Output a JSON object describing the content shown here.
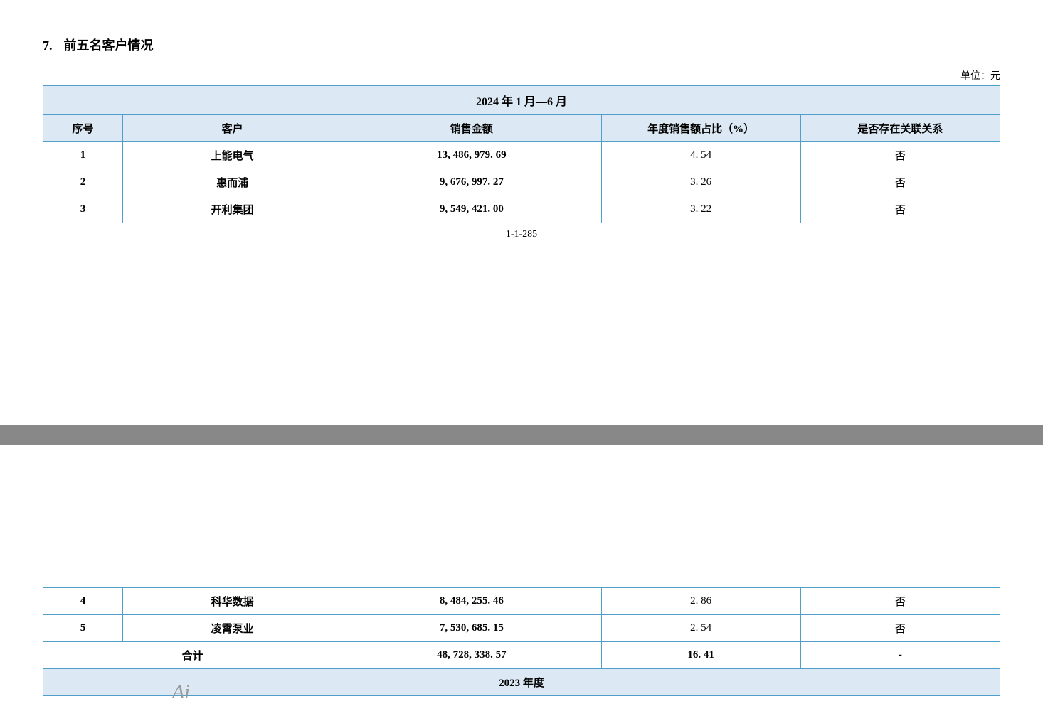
{
  "section": {
    "number": "7.",
    "title": "前五名客户情况"
  },
  "unit_label": "单位：元",
  "table": {
    "period_header": "2024 年 1 月—6 月",
    "columns": [
      {
        "key": "seq",
        "label": "序号"
      },
      {
        "key": "customer",
        "label": "客户"
      },
      {
        "key": "amount",
        "label": "销售金额"
      },
      {
        "key": "percent",
        "label": "年度销售额占比（%）"
      },
      {
        "key": "relation",
        "label": "是否存在关联关系"
      }
    ],
    "top_rows": [
      {
        "seq": "1",
        "customer": "上能电气",
        "amount": "13, 486, 979. 69",
        "percent": "4. 54",
        "relation": "否"
      },
      {
        "seq": "2",
        "customer": "惠而浦",
        "amount": "9, 676, 997. 27",
        "percent": "3. 26",
        "relation": "否"
      },
      {
        "seq": "3",
        "customer": "开利集团",
        "amount": "9, 549, 421. 00",
        "percent": "3. 22",
        "relation": "否"
      }
    ],
    "page_number": "1-1-285",
    "bottom_rows": [
      {
        "seq": "4",
        "customer": "科华数据",
        "amount": "8, 484, 255. 46",
        "percent": "2. 86",
        "relation": "否"
      },
      {
        "seq": "5",
        "customer": "凌霄泵业",
        "amount": "7, 530, 685. 15",
        "percent": "2. 54",
        "relation": "否"
      }
    ],
    "summary_row": {
      "label": "合计",
      "amount": "48, 728, 338. 57",
      "percent": "16. 41",
      "relation": "-"
    },
    "next_period_label": "2023 年度"
  },
  "ai_label": "Ai"
}
